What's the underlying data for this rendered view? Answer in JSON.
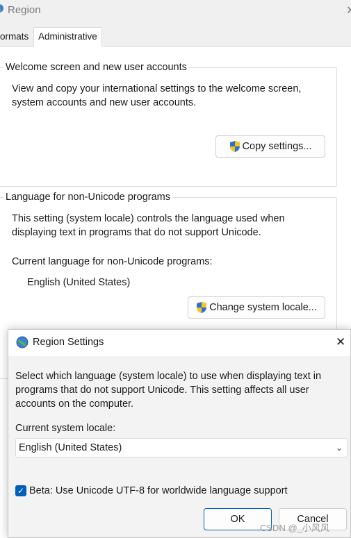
{
  "window": {
    "title": "Region",
    "tabs": [
      {
        "label": "ormats"
      },
      {
        "label": "Administrative"
      }
    ]
  },
  "welcome_group": {
    "title": "Welcome screen and new user accounts",
    "description_line1": "View and copy your international settings to the welcome screen,",
    "description_line2": "system accounts and new user accounts.",
    "copy_button": "Copy settings..."
  },
  "unicode_group": {
    "title": "Language for non-Unicode programs",
    "description_line1": "This setting (system locale) controls the language used when",
    "description_line2": "displaying text in programs that do not support Unicode.",
    "current_label": "Current language for non-Unicode programs:",
    "current_value": "English (United States)",
    "change_button": "Change system locale..."
  },
  "dialog": {
    "title": "Region Settings",
    "description_line1": "Select which language (system locale) to use when displaying text in",
    "description_line2": "programs that do not support Unicode. This setting affects all user",
    "description_line3": "accounts on the computer.",
    "locale_label": "Current system locale:",
    "locale_value": "English (United States)",
    "beta_checkbox_label": "Beta: Use Unicode UTF-8 for worldwide language support",
    "beta_checked": true,
    "ok_button": "OK",
    "cancel_button": "Cancel"
  },
  "watermark": "CSDN @_小风风",
  "colors": {
    "accent": "#005fb8",
    "shield_blue": "#2a6fd6",
    "shield_yellow": "#f5c518"
  }
}
